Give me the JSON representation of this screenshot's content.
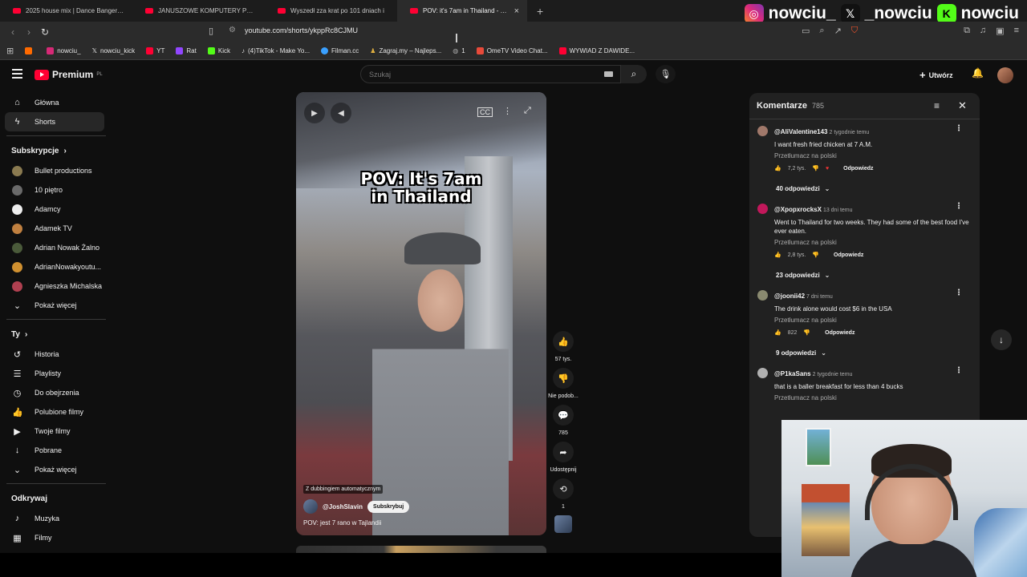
{
  "tabs": [
    {
      "title": "2025 house mix | Dance Bangers - Yo",
      "active": false
    },
    {
      "title": "JANUSZOWE KOMPUTERY PC Niemie",
      "active": false
    },
    {
      "title": "Wyszedł zza krat po 101 dniach i",
      "active": false
    },
    {
      "title": "POV: it's 7am in Thailand - YouTu",
      "active": true
    }
  ],
  "address": {
    "url": "youtube.com/shorts/ykppRc8CJMU"
  },
  "bookmarks": [
    {
      "label": "",
      "color": "#ff6a00"
    },
    {
      "label": "nowciu_",
      "color": "#d62976"
    },
    {
      "label": "nowciu_kick",
      "color": "#dddddd"
    },
    {
      "label": "YT",
      "color": "#ff0033"
    },
    {
      "label": "Rat",
      "color": "#9146ff"
    },
    {
      "label": "Kick",
      "color": "#53fc18"
    },
    {
      "label": "(4)TikTok - Make Yo...",
      "color": "#eeeeee"
    },
    {
      "label": "Filman.cc",
      "color": "#3aa0ff"
    },
    {
      "label": "Zagraj.my – Najleps...",
      "color": "#e0b040"
    },
    {
      "label": "1",
      "color": "#888888"
    },
    {
      "label": "OmeTV Video Chat...",
      "color": "#e84a3a"
    },
    {
      "label": "WYWIAD Z DAWIDE...",
      "color": "#ff0033"
    }
  ],
  "overlay": {
    "instagram": "nowciu_",
    "x": "_nowciu",
    "kick": "nowciu"
  },
  "youtube": {
    "logo_text": "Premium",
    "logo_sup": "PL",
    "search_placeholder": "Szukaj",
    "create_label": "Utwórz"
  },
  "sidebar": {
    "main": [
      {
        "label": "Główna",
        "icon": "home-icon",
        "glyph": "⌂"
      },
      {
        "label": "Shorts",
        "icon": "shorts-icon",
        "glyph": "ϟ",
        "active": true
      }
    ],
    "subs_title": "Subskrypcje",
    "subs": [
      {
        "label": "Bullet productions",
        "color": "#8a7a50"
      },
      {
        "label": "10 piętro",
        "color": "#6a6a6a"
      },
      {
        "label": "Adamcy",
        "color": "#eeeeee"
      },
      {
        "label": "Adamek TV",
        "color": "#c08040"
      },
      {
        "label": "Adrian Nowak Żalno",
        "color": "#4a5a3a"
      },
      {
        "label": "AdrianNowakyoutu...",
        "color": "#d09030"
      },
      {
        "label": "Agnieszka Michalska",
        "color": "#b04050"
      }
    ],
    "subs_more": "Pokaż więcej",
    "you_title": "Ty",
    "you": [
      {
        "label": "Historia",
        "icon": "history-icon",
        "glyph": "↺"
      },
      {
        "label": "Playlisty",
        "icon": "playlist-icon",
        "glyph": "☰"
      },
      {
        "label": "Do obejrzenia",
        "icon": "clock-icon",
        "glyph": "◷"
      },
      {
        "label": "Polubione filmy",
        "icon": "thumb-up-icon",
        "glyph": "👍"
      },
      {
        "label": "Twoje filmy",
        "icon": "video-icon",
        "glyph": "▶"
      },
      {
        "label": "Pobrane",
        "icon": "download-icon",
        "glyph": "↓"
      }
    ],
    "you_more": "Pokaż więcej",
    "explore_title": "Odkrywaj",
    "explore": [
      {
        "label": "Muzyka",
        "icon": "music-icon",
        "glyph": "♪"
      },
      {
        "label": "Filmy",
        "icon": "film-icon",
        "glyph": "▦"
      }
    ]
  },
  "video": {
    "overlay_title": "POV: It's 7am in Thailand",
    "dub_badge": "Z dubbingiem automatycznym",
    "channel": "@JoshSlavin",
    "subscribe": "Subskrybuj",
    "description": "POV: jest 7 rano w Tajlandii"
  },
  "actions": {
    "likes": "57 tys.",
    "dislike": "Nie podob...",
    "comments": "785",
    "share": "Udostępnij",
    "remix": "1"
  },
  "comments": {
    "title": "Komentarze",
    "count": "785",
    "translate": "Przetłumacz na polski",
    "reply": "Odpowiedz",
    "items": [
      {
        "author": "@AliValentine143",
        "time": "2 tygodnie temu",
        "text": "I want fresh fried chicken at 7 A.M.",
        "likes": "7,2 tys.",
        "replies": "40 odpowiedzi",
        "color": "#a0786a"
      },
      {
        "author": "@XpopxrocksX",
        "time": "13 dni temu",
        "text": "Went to Thailand for two weeks. They had some of the best food I've ever eaten.",
        "likes": "2,8 tys.",
        "replies": "23 odpowiedzi",
        "color": "#c2185b"
      },
      {
        "author": "@joonii42",
        "time": "7 dni temu",
        "text": "The drink alone would cost $6 in the USA",
        "likes": "822",
        "replies": "9 odpowiedzi",
        "color": "#8a8a70"
      },
      {
        "author": "@P1kaSans",
        "time": "2 tygodnie temu",
        "text": "that is a baller breakfast for less than 4 bucks",
        "likes": "",
        "replies": "",
        "color": "#b0b0b0"
      }
    ]
  }
}
